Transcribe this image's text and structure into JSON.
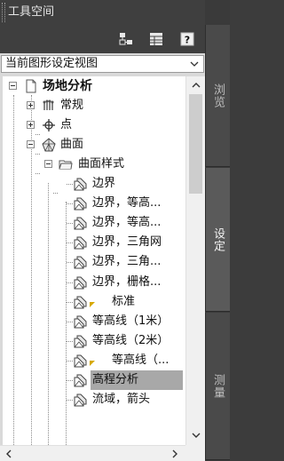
{
  "window": {
    "title": "工具空间"
  },
  "side_tabs": [
    {
      "label": "浏览",
      "active": false
    },
    {
      "label": "设定",
      "active": true
    },
    {
      "label": "测量",
      "active": false
    }
  ],
  "toolbar": {
    "icons": [
      "grid-icon",
      "table-icon",
      "help-icon"
    ],
    "help_label": "?"
  },
  "view_selector": {
    "value": "当前图形设定视图"
  },
  "tree": {
    "root": "场地分析",
    "nodes": [
      {
        "label": "常规",
        "icon": "general-icon"
      },
      {
        "label": "点",
        "icon": "point-icon"
      },
      {
        "label": "曲面",
        "icon": "surface-icon"
      },
      {
        "label": "曲面样式",
        "icon": "folder-icon"
      }
    ],
    "styles": [
      {
        "label": "边界",
        "marker": false,
        "highlighted": false
      },
      {
        "label": "边界，等高...",
        "marker": false,
        "highlighted": false
      },
      {
        "label": "边界，等高...",
        "marker": false,
        "highlighted": false
      },
      {
        "label": "边界，三角网",
        "marker": false,
        "highlighted": false
      },
      {
        "label": "边界，三角...",
        "marker": false,
        "highlighted": false
      },
      {
        "label": "边界，栅格...",
        "marker": false,
        "highlighted": false
      },
      {
        "label": "标准",
        "marker": true,
        "highlighted": false
      },
      {
        "label": "等高线（1米）",
        "marker": false,
        "highlighted": false
      },
      {
        "label": "等高线（2米）",
        "marker": false,
        "highlighted": false
      },
      {
        "label": "等高线（...",
        "marker": true,
        "highlighted": false
      },
      {
        "label": "高程分析",
        "marker": false,
        "highlighted": true
      },
      {
        "label": "流域，箭头",
        "marker": false,
        "highlighted": false
      }
    ]
  },
  "colors": {
    "frame": "#3f3f3f",
    "panel": "#d9d9d9",
    "selection": "#a8a8a8",
    "tab_active": "#5a5a5a"
  }
}
